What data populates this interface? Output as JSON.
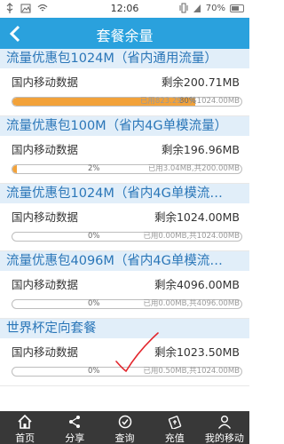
{
  "status_bar": {
    "time": "12:06",
    "battery": "70%",
    "battery_level": 0.7,
    "icons": [
      "usb-icon",
      "image-icon",
      "wifi-icon",
      "vibrate-icon",
      "signal-icon",
      "battery-icon"
    ]
  },
  "header": {
    "title": "套餐余量",
    "back_icon": "chevron-left-icon"
  },
  "packages": [
    {
      "title": "流量优惠包1024M（省内通用流量）",
      "label": "国内移动数据",
      "remaining": "剩余200.71MB",
      "percent_text": "80%",
      "percent": 80,
      "used": "已用823.29…",
      "total": "共1024.00MB"
    },
    {
      "title": "流量优惠包100M（省内4G单模流量）",
      "label": "国内移动数据",
      "remaining": "剩余196.96MB",
      "percent_text": "2%",
      "percent": 2,
      "used": "已用3.04MB,",
      "total": "共200.00MB"
    },
    {
      "title": "流量优惠包1024M（省内4G单模流…",
      "label": "国内移动数据",
      "remaining": "剩余1024.00MB",
      "percent_text": "0%",
      "percent": 0,
      "used": "已用0.00MB,",
      "total": "共1024.00MB"
    },
    {
      "title": "流量优惠包4096M（省内4G单模流…",
      "label": "国内移动数据",
      "remaining": "剩余4096.00MB",
      "percent_text": "0%",
      "percent": 0,
      "used": "已用0.00MB,",
      "total": "共4096.00MB"
    },
    {
      "title": "世界杯定向套餐",
      "label": "国内移动数据",
      "remaining": "剩余1023.50MB",
      "percent_text": "0%",
      "percent": 0,
      "used": "已用0.50MB,",
      "total": "共1024.00MB"
    }
  ],
  "annotation": {
    "checkmark_color": "#e3262d"
  },
  "nav": [
    {
      "label": "首页",
      "icon": "home-icon"
    },
    {
      "label": "分享",
      "icon": "share-icon"
    },
    {
      "label": "查询",
      "icon": "check-circle-icon"
    },
    {
      "label": "充值",
      "icon": "recharge-icon"
    },
    {
      "label": "我的移动",
      "icon": "user-icon"
    }
  ],
  "colors": {
    "accent": "#2aa1dd",
    "header_bg": "#e1eef9",
    "header_text": "#2a76b8",
    "progress": "#f2a23a",
    "nav_bg": "#383838"
  }
}
